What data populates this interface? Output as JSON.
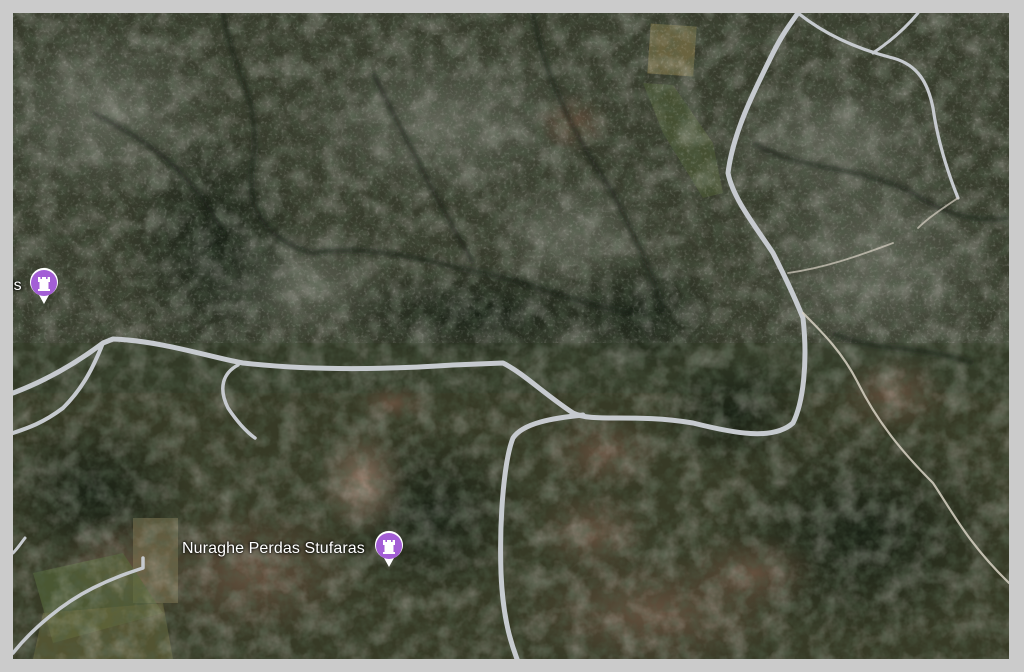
{
  "map": {
    "view": "satellite",
    "colors": {
      "pin": "#a35ed6",
      "road": "#c9cdd2",
      "path": "#d8d2c4"
    },
    "places": [
      {
        "name": "Nuraghe Perdas Stufaras",
        "icon": "castle-tower-icon"
      },
      {
        "name": "nis",
        "icon": "castle-tower-icon"
      }
    ]
  }
}
